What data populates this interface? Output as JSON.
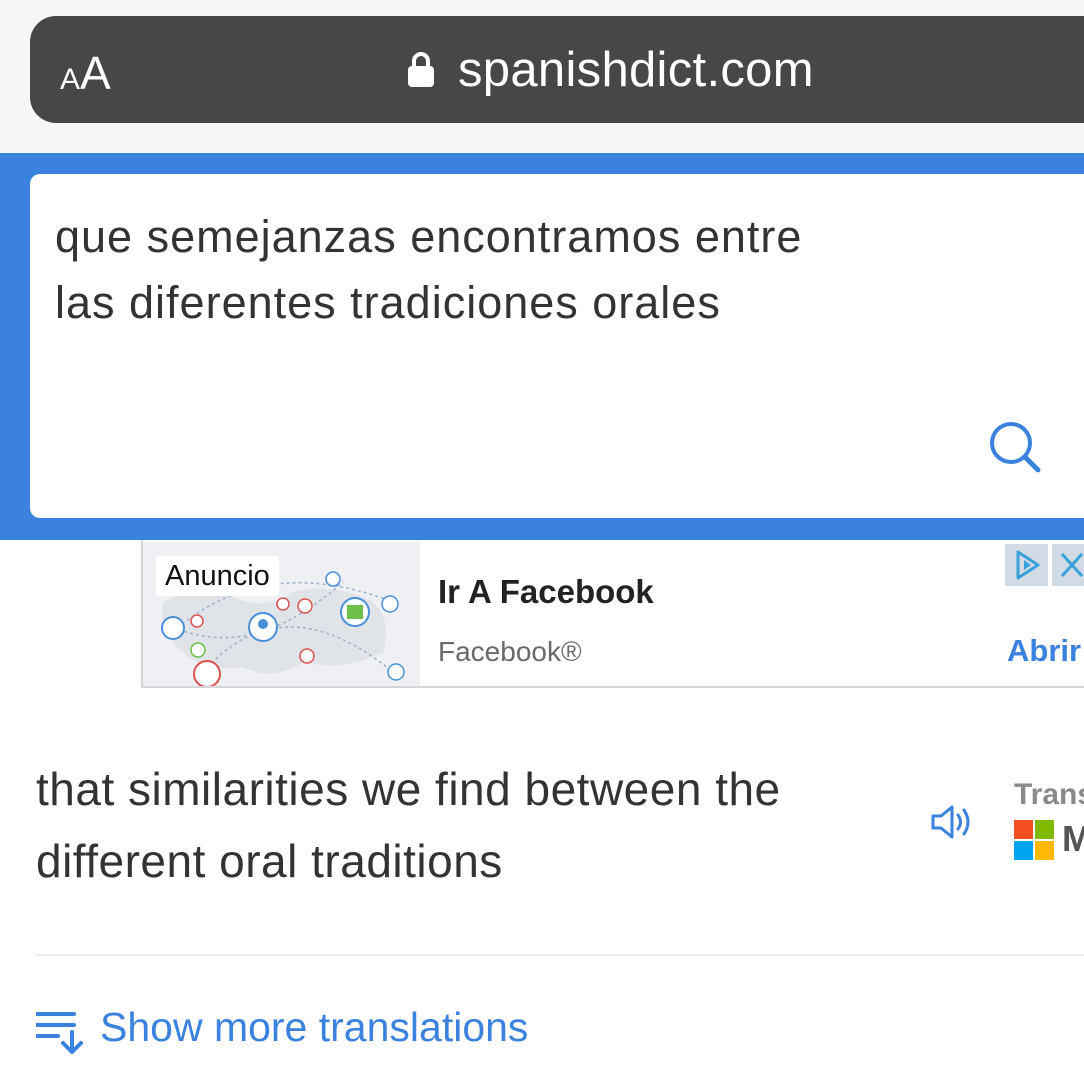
{
  "browser": {
    "text_size_small": "A",
    "text_size_large": "A",
    "url": "spanishdict.com"
  },
  "search": {
    "query": "que semejanzas encontramos entre\nlas diferentes tradiciones orales"
  },
  "ad": {
    "badge": "Anuncio",
    "title": "Ir A Facebook",
    "subtitle": "Facebook®",
    "cta": "Abrir"
  },
  "translation": {
    "text": "that similarities we find between the\ndifferent oral traditions",
    "provider_label": "Trans",
    "provider_name": "M",
    "provider_logo_colors": [
      "#f25022",
      "#7fba00",
      "#00a4ef",
      "#ffb900"
    ]
  },
  "more": {
    "label": "Show more translations"
  },
  "colors": {
    "accent": "#3b82df",
    "address_bar": "#474747"
  }
}
